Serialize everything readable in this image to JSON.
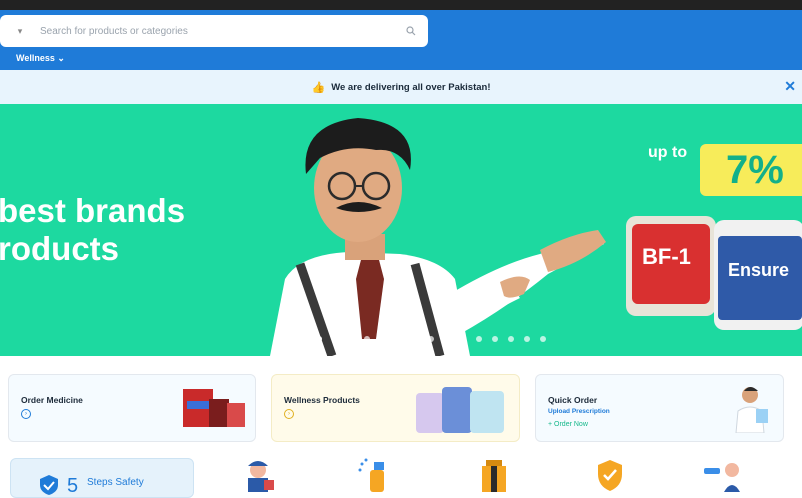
{
  "search": {
    "placeholder": "Search for products or categories"
  },
  "nav": {
    "wellness_label": "Wellness ⌄"
  },
  "notice": {
    "text": "We are delivering all over Pakistan!"
  },
  "banner": {
    "headline": "best brands\nroducts",
    "offer_prefix": "up to",
    "offer_value": "7%",
    "product_1": "BF-1",
    "product_2": "Ensure"
  },
  "cards": {
    "order_medicine": {
      "title": "Order Medicine"
    },
    "wellness_products": {
      "title": "Wellness Products"
    },
    "quick_order": {
      "title": "Quick Order",
      "subtitle": "Upload Prescription",
      "link": "+ Order Now"
    }
  },
  "steps": {
    "number": "5",
    "label": "Steps Safety"
  },
  "colors": {
    "brand_blue": "#1f7bd8",
    "banner_green": "#1dd9a0",
    "accent_yellow": "#f7ec5a"
  }
}
